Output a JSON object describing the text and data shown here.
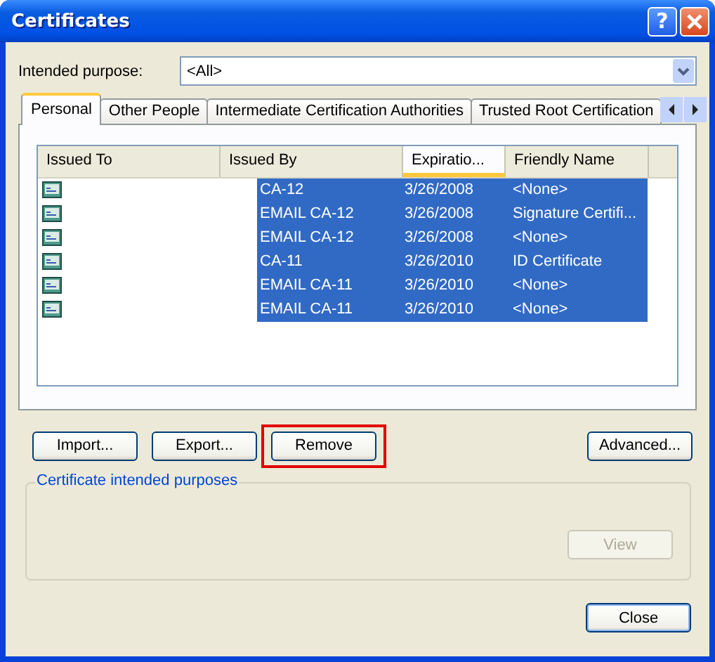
{
  "window": {
    "title": "Certificates"
  },
  "title_buttons": [
    {
      "kind": "help",
      "label": "?"
    },
    {
      "kind": "close"
    }
  ],
  "intended_purpose": {
    "label": "Intended purpose:",
    "value": "<All>"
  },
  "tabs": [
    {
      "label": "Personal",
      "selected": true
    },
    {
      "label": "Other People",
      "selected": false
    },
    {
      "label": "Intermediate Certification Authorities",
      "selected": false
    },
    {
      "label": "Trusted Root Certification",
      "selected": false
    }
  ],
  "table": {
    "columns": [
      {
        "label": "Issued To",
        "sorted": false
      },
      {
        "label": "Issued By",
        "sorted": false
      },
      {
        "label": "Expiratio...",
        "sorted": true
      },
      {
        "label": "Friendly Name",
        "sorted": false
      }
    ],
    "rows": [
      {
        "issued_by": "CA-12",
        "expiration": "3/26/2008",
        "friendly_name": "<None>",
        "selected": true
      },
      {
        "issued_by": "EMAIL CA-12",
        "expiration": "3/26/2008",
        "friendly_name": "Signature Certifi...",
        "selected": true
      },
      {
        "issued_by": "EMAIL CA-12",
        "expiration": "3/26/2008",
        "friendly_name": "<None>",
        "selected": true
      },
      {
        "issued_by": "CA-11",
        "expiration": "3/26/2010",
        "friendly_name": "ID Certificate",
        "selected": true
      },
      {
        "issued_by": "EMAIL CA-11",
        "expiration": "3/26/2010",
        "friendly_name": "<None>",
        "selected": true
      },
      {
        "issued_by": "EMAIL CA-11",
        "expiration": "3/26/2010",
        "friendly_name": "<None>",
        "selected": true
      }
    ]
  },
  "action_buttons": [
    {
      "label": "Import..."
    },
    {
      "label": "Export..."
    },
    {
      "label": "Remove",
      "highlighted": true
    }
  ],
  "advanced_button": {
    "label": "Advanced..."
  },
  "purposes_group": {
    "title": "Certificate intended purposes",
    "view_button": {
      "label": "View",
      "disabled": true
    }
  },
  "close_button": {
    "label": "Close"
  }
}
